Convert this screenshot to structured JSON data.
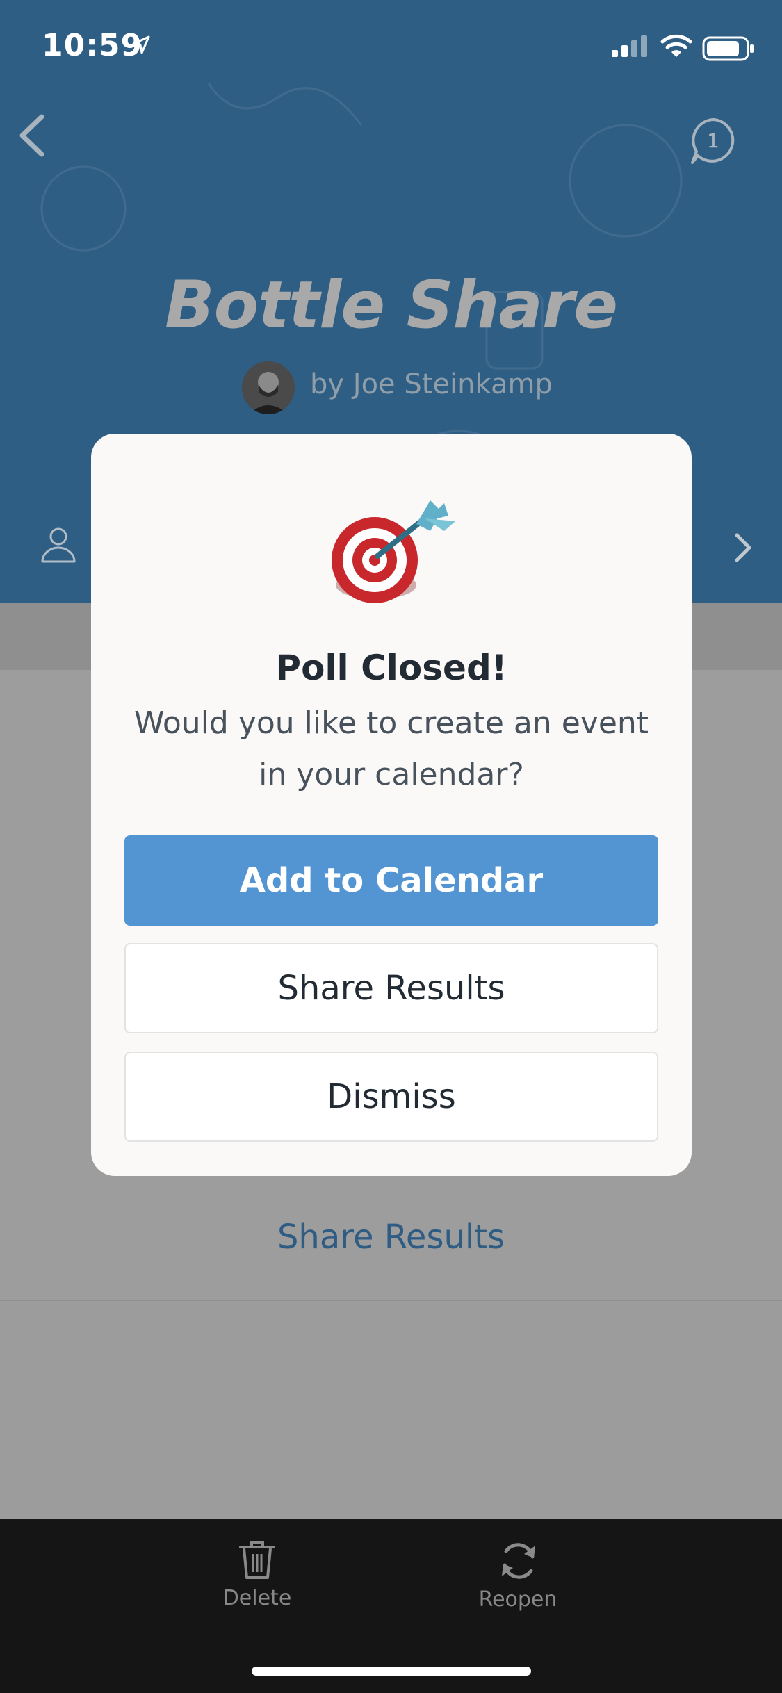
{
  "status_bar": {
    "time": "10:59"
  },
  "header": {
    "title": "Bottle Share",
    "byline": "by Joe Steinkamp",
    "comment_count": "1"
  },
  "content": {
    "share_results_link": "Share Results"
  },
  "bottom_bar": {
    "delete_label": "Delete",
    "reopen_label": "Reopen"
  },
  "modal": {
    "title": "Poll Closed!",
    "message": "Would you like to create an event in your calendar?",
    "primary_button": "Add to Calendar",
    "share_button": "Share Results",
    "dismiss_button": "Dismiss"
  },
  "colors": {
    "header_blue": "#2f5e85",
    "primary_button": "#5295d2",
    "link_blue": "#2f5c82"
  }
}
